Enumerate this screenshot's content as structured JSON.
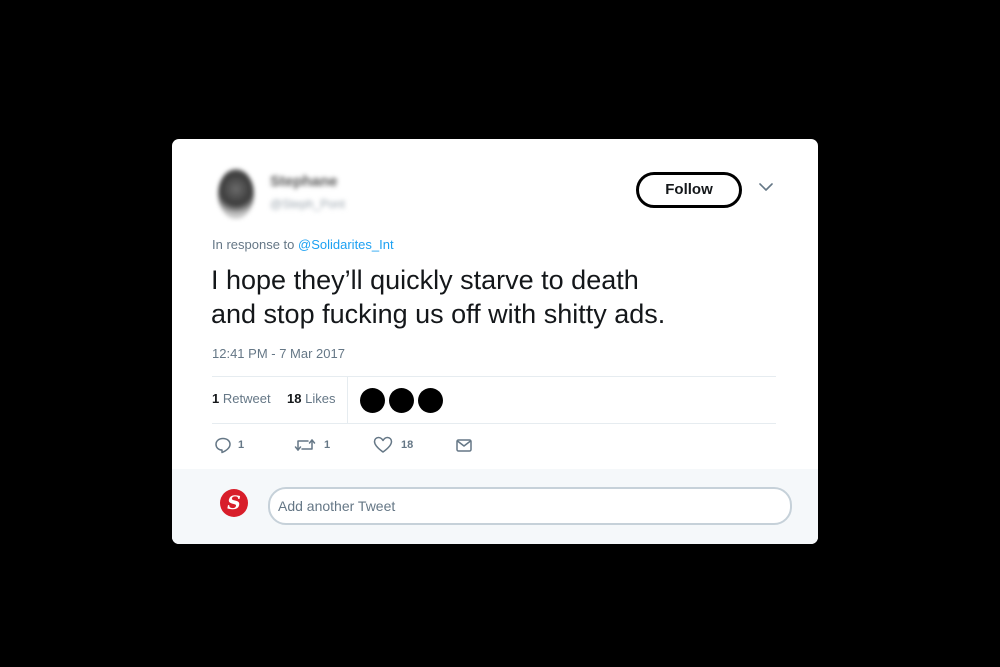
{
  "user": {
    "name": "Stephane",
    "handle": "@Steph_Pont"
  },
  "header": {
    "follow_label": "Follow"
  },
  "tweet": {
    "in_response_prefix": "In response to",
    "in_response_handle": "@Solidarites_Int",
    "text": "I hope they’ll quickly starve to death\nand stop fucking us off with shitty ads.",
    "timestamp": "12:41 PM - 7 Mar 2017"
  },
  "stats": {
    "retweets_count": "1",
    "retweets_label": "Retweet",
    "likes_count": "18",
    "likes_label": "Likes"
  },
  "actions": {
    "reply_count": "1",
    "retweet_count": "1",
    "like_count": "18"
  },
  "reply": {
    "placeholder": "Add another Tweet",
    "avatar_letter": "S"
  },
  "colors": {
    "link": "#1da1f2",
    "secondary_text": "#657786",
    "avatar_brand": "#d81e2a"
  },
  "icons": [
    "chevron-down-icon",
    "reply-icon",
    "retweet-icon",
    "heart-icon",
    "envelope-icon"
  ]
}
